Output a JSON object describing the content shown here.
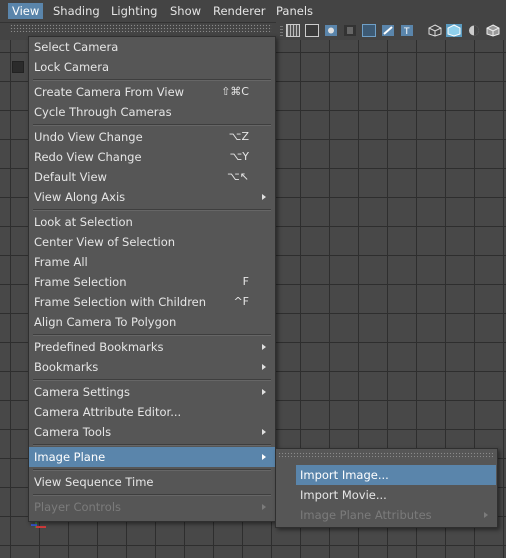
{
  "menubar": {
    "items": [
      "View",
      "Shading",
      "Lighting",
      "Show",
      "Renderer",
      "Panels"
    ],
    "active": "View"
  },
  "view_menu": {
    "items": [
      {
        "label": "Select Camera",
        "shortcut": "",
        "submenu": false
      },
      {
        "label": "Lock Camera",
        "shortcut": "",
        "submenu": false
      },
      {
        "label": "Create Camera From View",
        "shortcut": "⇧⌘C",
        "submenu": false
      },
      {
        "label": "Cycle Through Cameras",
        "shortcut": "",
        "submenu": false
      },
      {
        "label": "Undo View Change",
        "shortcut": "⌥Z",
        "submenu": false
      },
      {
        "label": "Redo View Change",
        "shortcut": "⌥Y",
        "submenu": false
      },
      {
        "label": "Default View",
        "shortcut": "⌥↖",
        "submenu": false
      },
      {
        "label": "View Along Axis",
        "shortcut": "",
        "submenu": true
      },
      {
        "label": "Look at Selection",
        "shortcut": "",
        "submenu": false
      },
      {
        "label": "Center View of Selection",
        "shortcut": "",
        "submenu": false
      },
      {
        "label": "Frame All",
        "shortcut": "",
        "submenu": false
      },
      {
        "label": "Frame Selection",
        "shortcut": "F",
        "submenu": false
      },
      {
        "label": "Frame Selection with Children",
        "shortcut": "^F",
        "submenu": false
      },
      {
        "label": "Align Camera To Polygon",
        "shortcut": "",
        "submenu": false
      },
      {
        "label": "Predefined Bookmarks",
        "shortcut": "",
        "submenu": true
      },
      {
        "label": "Bookmarks",
        "shortcut": "",
        "submenu": true
      },
      {
        "label": "Camera Settings",
        "shortcut": "",
        "submenu": true
      },
      {
        "label": "Camera Attribute Editor...",
        "shortcut": "",
        "submenu": false
      },
      {
        "label": "Camera Tools",
        "shortcut": "",
        "submenu": true
      },
      {
        "label": "Image Plane",
        "shortcut": "",
        "submenu": true,
        "highlighted": true
      },
      {
        "label": "View Sequence Time",
        "shortcut": "",
        "submenu": false
      },
      {
        "label": "Player Controls",
        "shortcut": "",
        "submenu": true,
        "disabled": true
      }
    ]
  },
  "image_plane_submenu": {
    "items": [
      {
        "label": "Import Image...",
        "highlighted": true
      },
      {
        "label": "Import Movie..."
      },
      {
        "label": "Image Plane Attributes",
        "disabled": true,
        "submenu": true
      }
    ]
  },
  "toolbar": {
    "icons": [
      "grid-icon",
      "film-gate-icon",
      "resolution-gate-icon",
      "gate-mask-icon",
      "field-chart-icon",
      "safe-action-icon",
      "safe-title-icon",
      "wireframe-cube-icon",
      "smooth-shade-cube-icon",
      "shade-toggle-icon",
      "wireframe-on-shaded-icon"
    ]
  },
  "colors": {
    "accent": "#5a85ab",
    "menu_bg": "#565656",
    "viewport_bg": "#484848"
  }
}
